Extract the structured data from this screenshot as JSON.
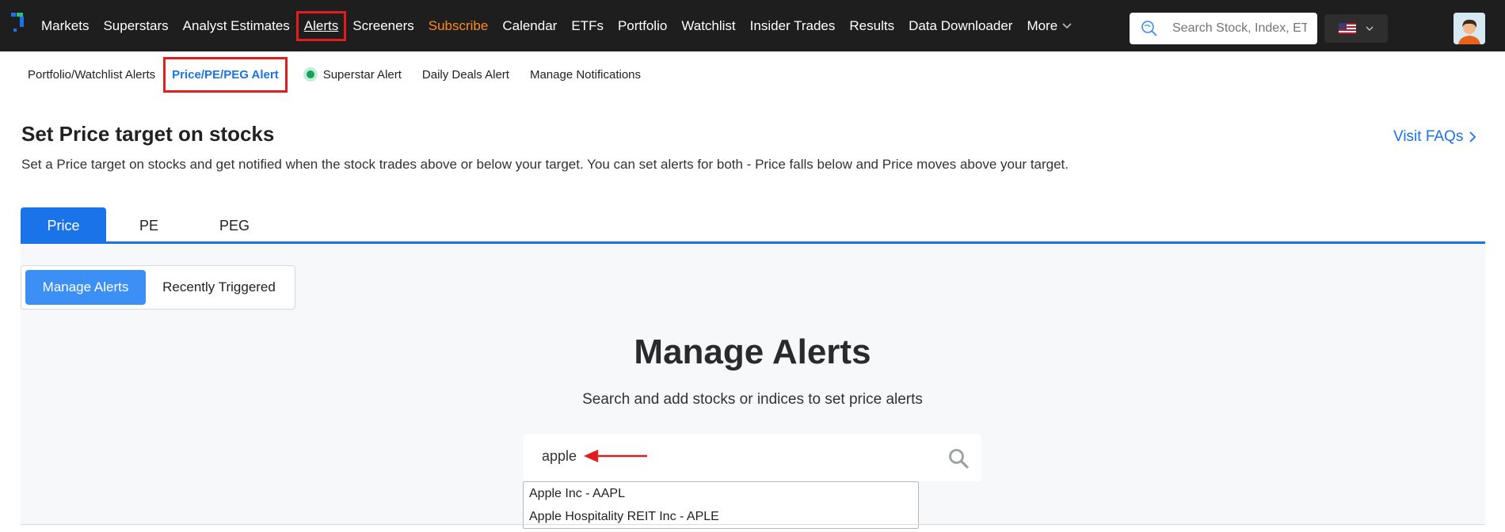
{
  "topnav": {
    "items": [
      {
        "label": "Markets"
      },
      {
        "label": "Superstars"
      },
      {
        "label": "Analyst Estimates"
      },
      {
        "label": "Alerts"
      },
      {
        "label": "Screeners"
      },
      {
        "label": "Subscribe"
      },
      {
        "label": "Calendar"
      },
      {
        "label": "ETFs"
      },
      {
        "label": "Portfolio"
      },
      {
        "label": "Watchlist"
      },
      {
        "label": "Insider Trades"
      },
      {
        "label": "Results"
      },
      {
        "label": "Data Downloader"
      },
      {
        "label": "More"
      }
    ],
    "search_placeholder": "Search Stock, Index, ETF",
    "colors": {
      "bar": "#1e1e1e",
      "subscribe": "#ff8a1f",
      "highlight_box": "#e11d1d"
    }
  },
  "subnav": {
    "items": [
      {
        "label": "Portfolio/Watchlist Alerts"
      },
      {
        "label": "Price/PE/PEG Alert"
      },
      {
        "label": "Superstar Alert"
      },
      {
        "label": "Daily Deals Alert"
      },
      {
        "label": "Manage Notifications"
      }
    ]
  },
  "header": {
    "title": "Set Price target on stocks",
    "description": "Set a Price target on stocks and get notified when the stock trades above or below your target. You can set alerts for both - Price falls below and Price moves above your target.",
    "faq_label": "Visit FAQs"
  },
  "tabs": [
    {
      "label": "Price"
    },
    {
      "label": "PE"
    },
    {
      "label": "PEG"
    }
  ],
  "toggle": {
    "manage_label": "Manage Alerts",
    "triggered_label": "Recently Triggered"
  },
  "manage": {
    "title": "Manage Alerts",
    "subtitle": "Search and add stocks or indices to set price alerts",
    "search_value": "apple",
    "results": [
      {
        "label": "Apple Inc - AAPL"
      },
      {
        "label": "Apple Hospitality REIT Inc - APLE"
      }
    ]
  },
  "accent_color": "#1a73e8"
}
